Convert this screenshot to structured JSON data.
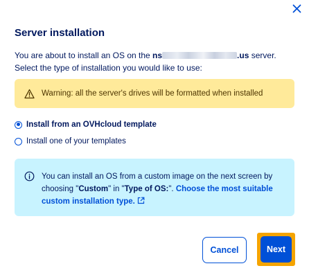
{
  "dialog": {
    "close_icon": "close-icon",
    "title": "Server installation",
    "intro_before": "You are about to install an OS on the ",
    "server_prefix": "ns",
    "server_suffix": ".us",
    "intro_after": " server. Select the type of installation you would like to use:",
    "warning": {
      "icon": "warning-triangle-icon",
      "text": "Warning: all the server's drives will be formatted when installed",
      "color": "#ffea9a"
    },
    "options": [
      {
        "label": "Install from an OVHcloud template",
        "checked": true
      },
      {
        "label": "Install one of your templates",
        "checked": false
      }
    ],
    "info": {
      "icon": "info-icon",
      "text_before": "You can install an OS from a custom image on the next screen by choosing \"",
      "custom_word": "Custom",
      "text_mid": "\" in \"",
      "type_word": "Type of OS:",
      "text_after": "\". ",
      "link_text": "Choose the most suitable custom installation type.",
      "link_icon": "external-link-icon",
      "color": "#c8f3ff"
    },
    "buttons": {
      "cancel_label": "Cancel",
      "next_label": "Next"
    }
  },
  "colors": {
    "primary": "#0050d7",
    "text": "#00185e",
    "focus_ring": "#f5a400"
  }
}
